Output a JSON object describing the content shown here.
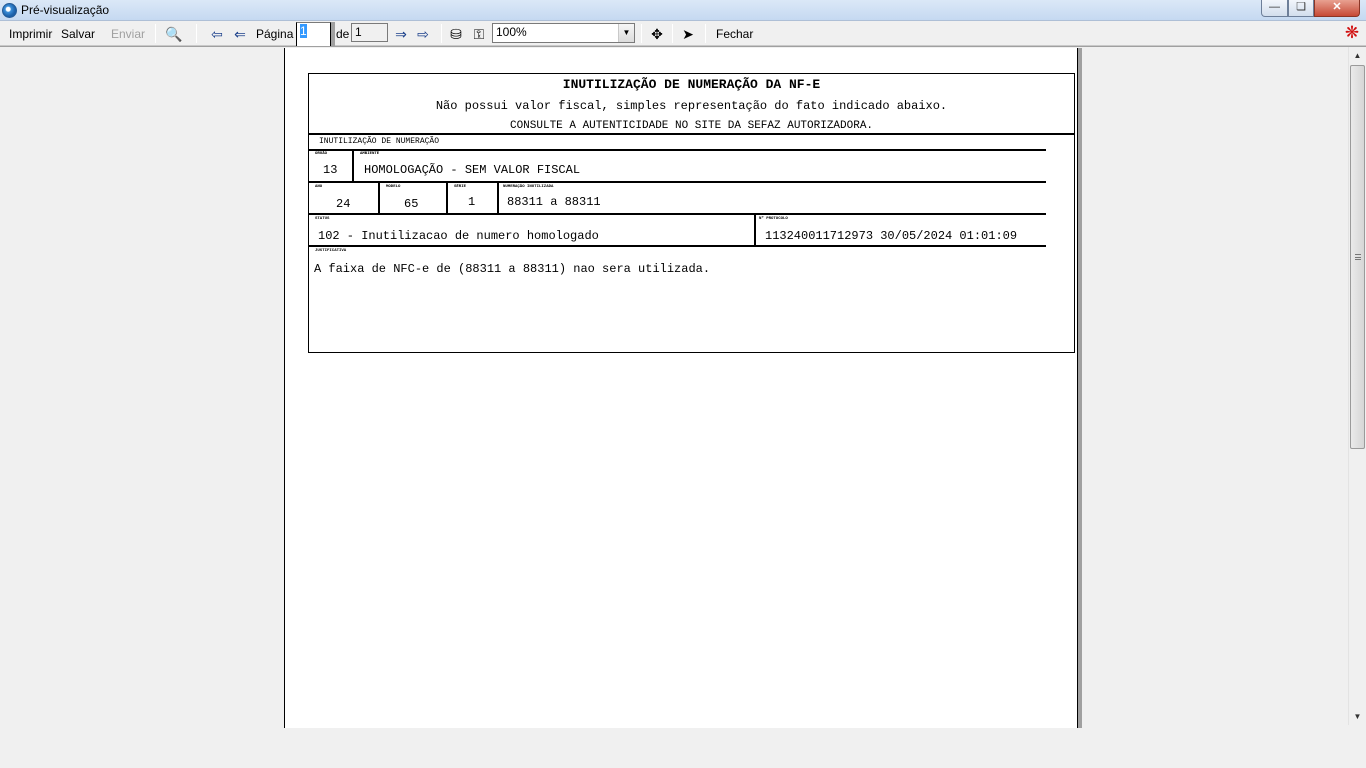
{
  "window": {
    "title": "Pré-visualização"
  },
  "toolbar": {
    "print": "Imprimir",
    "save": "Salvar",
    "send": "Enviar",
    "page_label": "Página",
    "page_current": "1",
    "of_label": "de",
    "page_total": "1",
    "zoom": "100%",
    "close": "Fechar"
  },
  "document": {
    "title": "INUTILIZAÇÃO DE NUMERAÇÃO DA NF-E",
    "subtitle": "Não possui valor fiscal, simples representação do fato indicado abaixo.",
    "notice": "CONSULTE A AUTENTICIDADE NO SITE DA SEFAZ AUTORIZADORA.",
    "section": "INUTILIZAÇÃO DE NUMERAÇÃO",
    "orgao": {
      "label": "ORGÃO",
      "value": "13"
    },
    "ambiente": {
      "label": "AMBIENTE",
      "value": "HOMOLOGAÇÃO - SEM VALOR FISCAL"
    },
    "ano": {
      "label": "ANO",
      "value": "24"
    },
    "modelo": {
      "label": "MODELO",
      "value": "65"
    },
    "serie": {
      "label": "SÉRIE",
      "value": "1"
    },
    "numeracao": {
      "label": "NUMERAÇÃO INUTILIZADA",
      "value": "88311 a 88311"
    },
    "status": {
      "label": "STATUS",
      "value": "102 - Inutilizacao de numero homologado"
    },
    "protocolo": {
      "label": "Nº PROTOCOLO",
      "value": "113240011712973 30/05/2024 01:01:09"
    },
    "justificativa": {
      "label": "JUSTIFICATIVA",
      "value": "A faixa de NFC-e de (88311 a 88311) nao sera utilizada."
    }
  }
}
